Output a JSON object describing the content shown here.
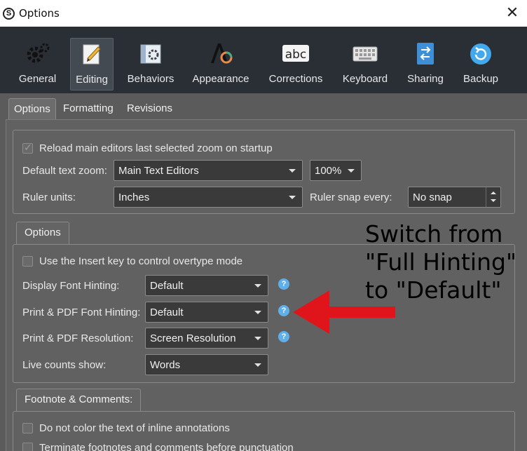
{
  "window": {
    "title": "Options",
    "app_icon": "S"
  },
  "toolbar": {
    "items": [
      {
        "label": "General",
        "icon": "gears-icon"
      },
      {
        "label": "Editing",
        "icon": "pencil-page-icon"
      },
      {
        "label": "Behaviors",
        "icon": "gear-window-icon"
      },
      {
        "label": "Appearance",
        "icon": "color-letter-icon"
      },
      {
        "label": "Corrections",
        "icon": "abc-icon"
      },
      {
        "label": "Keyboard",
        "icon": "keyboard-icon"
      },
      {
        "label": "Sharing",
        "icon": "sync-arrows-icon"
      },
      {
        "label": "Backup",
        "icon": "backup-circle-icon"
      }
    ],
    "active": "Editing"
  },
  "subtabs": [
    "Options",
    "Formatting",
    "Revisions"
  ],
  "zoom_group": {
    "reload_label": "Reload main editors last selected zoom on startup",
    "reload_checked": true,
    "default_zoom_label": "Default text zoom:",
    "default_zoom_value": "Main Text Editors",
    "zoom_percent": "100%",
    "ruler_units_label": "Ruler units:",
    "ruler_units_value": "Inches",
    "ruler_snap_label": "Ruler snap every:",
    "ruler_snap_value": "No snap"
  },
  "options_group": {
    "tab_label": "Options",
    "insert_key_label": "Use the Insert key to control overtype mode",
    "insert_key_checked": false,
    "display_hinting_label": "Display Font Hinting:",
    "display_hinting_value": "Default",
    "print_hinting_label": "Print & PDF Font Hinting:",
    "print_hinting_value": "Default",
    "print_resolution_label": "Print & PDF Resolution:",
    "print_resolution_value": "Screen Resolution",
    "live_counts_label": "Live counts show:",
    "live_counts_value": "Words",
    "help_glyph": "?"
  },
  "footnote_group": {
    "tab_label": "Footnote & Comments:",
    "no_color_label": "Do not color the text of inline annotations",
    "terminate_label": "Terminate footnotes and comments before punctuation"
  },
  "annotation": {
    "lines": [
      "Switch from",
      "\"Full Hinting\"",
      "to \"Default\""
    ],
    "arrow_color": "#e0141b"
  },
  "colors": {
    "toolbar_bg": "#2a2f36",
    "panel_bg": "#616161",
    "help_blue": "#5fb0ea"
  }
}
